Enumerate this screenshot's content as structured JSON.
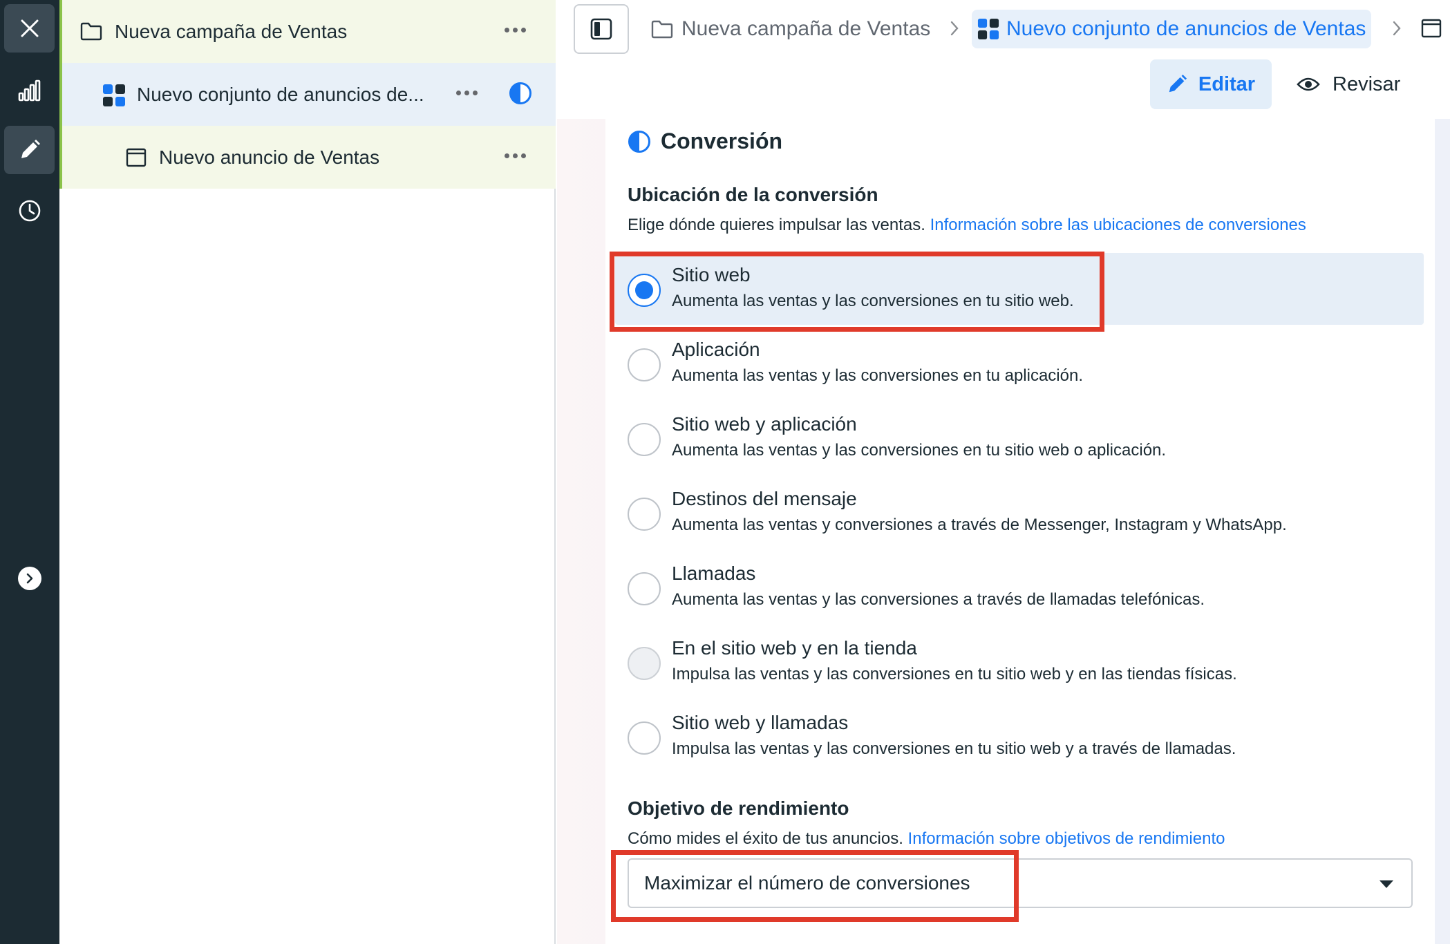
{
  "tree": {
    "campaign": {
      "label": "Nueva campaña de Ventas"
    },
    "adset": {
      "label": "Nuevo conjunto de anuncios de..."
    },
    "ad": {
      "label": "Nuevo anuncio de Ventas"
    }
  },
  "breadcrumb": {
    "campaign": "Nueva campaña de Ventas",
    "adset": "Nuevo conjunto de anuncios de Ventas"
  },
  "actions": {
    "edit_label": "Editar",
    "review_label": "Revisar"
  },
  "section": {
    "title": "Conversión",
    "location_heading": "Ubicación de la conversión",
    "location_description": "Elige dónde quieres impulsar las ventas.",
    "location_link": "Información sobre las ubicaciones de conversiones",
    "options": [
      {
        "title": "Sitio web",
        "description": "Aumenta las ventas y las conversiones en tu sitio web.",
        "state": "checked"
      },
      {
        "title": "Aplicación",
        "description": "Aumenta las ventas y las conversiones en tu aplicación.",
        "state": "unchecked"
      },
      {
        "title": "Sitio web y aplicación",
        "description": "Aumenta las ventas y las conversiones en tu sitio web o aplicación.",
        "state": "unchecked"
      },
      {
        "title": "Destinos del mensaje",
        "description": "Aumenta las ventas y conversiones a través de Messenger, Instagram y WhatsApp.",
        "state": "unchecked"
      },
      {
        "title": "Llamadas",
        "description": "Aumenta las ventas y las conversiones a través de llamadas telefónicas.",
        "state": "unchecked"
      },
      {
        "title": "En el sitio web y en la tienda",
        "description": "Impulsa las ventas y las conversiones en tu sitio web y en las tiendas físicas.",
        "state": "disabled"
      },
      {
        "title": "Sitio web y llamadas",
        "description": "Impulsa las ventas y las conversiones en tu sitio web y a través de llamadas.",
        "state": "unchecked"
      }
    ],
    "goal_heading": "Objetivo de rendimiento",
    "goal_description": "Cómo mides el éxito de tus anuncios.",
    "goal_link": "Información sobre objetivos de rendimiento",
    "goal_selected": "Maximizar el número de conversiones"
  },
  "colors": {
    "accent": "#1877f2",
    "rail": "#1c2b33",
    "highlight": "#e03a2a"
  }
}
